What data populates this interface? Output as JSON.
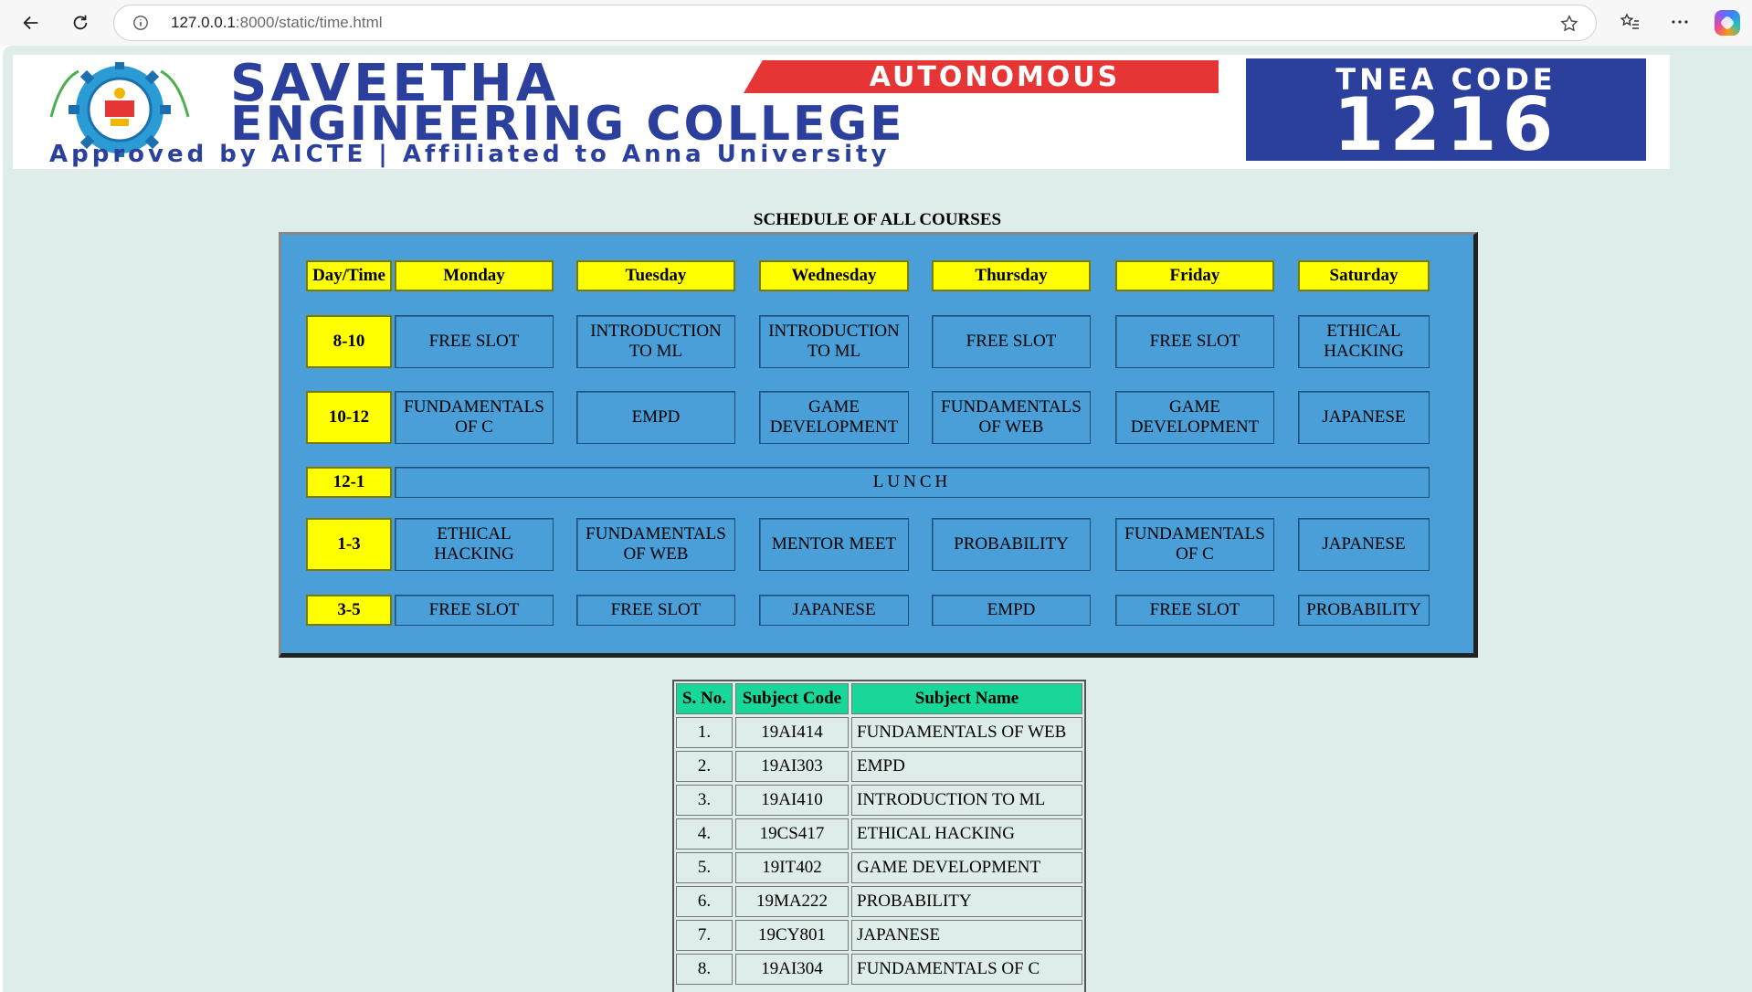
{
  "browser": {
    "url_host": "127.0.0.1",
    "url_rest": ":8000/static/time.html"
  },
  "banner": {
    "college_name_line1": "SAVEETHA",
    "college_name_line2": "ENGINEERING COLLEGE",
    "autonomous": "AUTONOMOUS",
    "affiliation": "Approved by AICTE  |  Affiliated to Anna University",
    "tnea_label": "TNEA CODE",
    "tnea_code": "1216",
    "colors": {
      "brand_blue": "#2b3f9c",
      "accent_red": "#e53535"
    }
  },
  "schedule": {
    "title": "SCHEDULE OF ALL COURSES",
    "header": [
      "Day/Time",
      "Monday",
      "Tuesday",
      "Wednesday",
      "Thursday",
      "Friday",
      "Saturday"
    ],
    "times": [
      "8-10",
      "10-12",
      "12-1",
      "1-3",
      "3-5"
    ],
    "rows": [
      [
        "FREE SLOT",
        "INTRODUCTION TO ML",
        "INTRODUCTION TO ML",
        "FREE SLOT",
        "FREE SLOT",
        "ETHICAL HACKING"
      ],
      [
        "FUNDAMENTALS OF C",
        "EMPD",
        "GAME DEVELOPMENT",
        "FUNDAMENTALS OF WEB",
        "GAME DEVELOPMENT",
        "JAPANESE"
      ],
      [
        "LUNCH"
      ],
      [
        "ETHICAL HACKING",
        "FUNDAMENTALS OF WEB",
        "MENTOR MEET",
        "PROBABILITY",
        "FUNDAMENTALS OF C",
        "JAPANESE"
      ],
      [
        "FREE SLOT",
        "FREE SLOT",
        "JAPANESE",
        "EMPD",
        "FREE SLOT",
        "PROBABILITY"
      ]
    ],
    "colors": {
      "grid_bg": "#4a9fd8",
      "header_bg": "#ffff00"
    }
  },
  "subjects": {
    "columns": [
      "S. No.",
      "Subject Code",
      "Subject Name"
    ],
    "rows": [
      [
        "1.",
        "19AI414",
        "FUNDAMENTALS OF WEB"
      ],
      [
        "2.",
        "19AI303",
        "EMPD"
      ],
      [
        "3.",
        "19AI410",
        "INTRODUCTION TO ML"
      ],
      [
        "4.",
        "19CS417",
        "ETHICAL HACKING"
      ],
      [
        "5.",
        "19IT402",
        "GAME DEVELOPMENT"
      ],
      [
        "6.",
        "19MA222",
        "PROBABILITY"
      ],
      [
        "7.",
        "19CY801",
        "JAPANESE"
      ],
      [
        "8.",
        "19AI304",
        "FUNDAMENTALS OF C"
      ]
    ],
    "colors": {
      "header_bg": "#19d69a"
    }
  }
}
